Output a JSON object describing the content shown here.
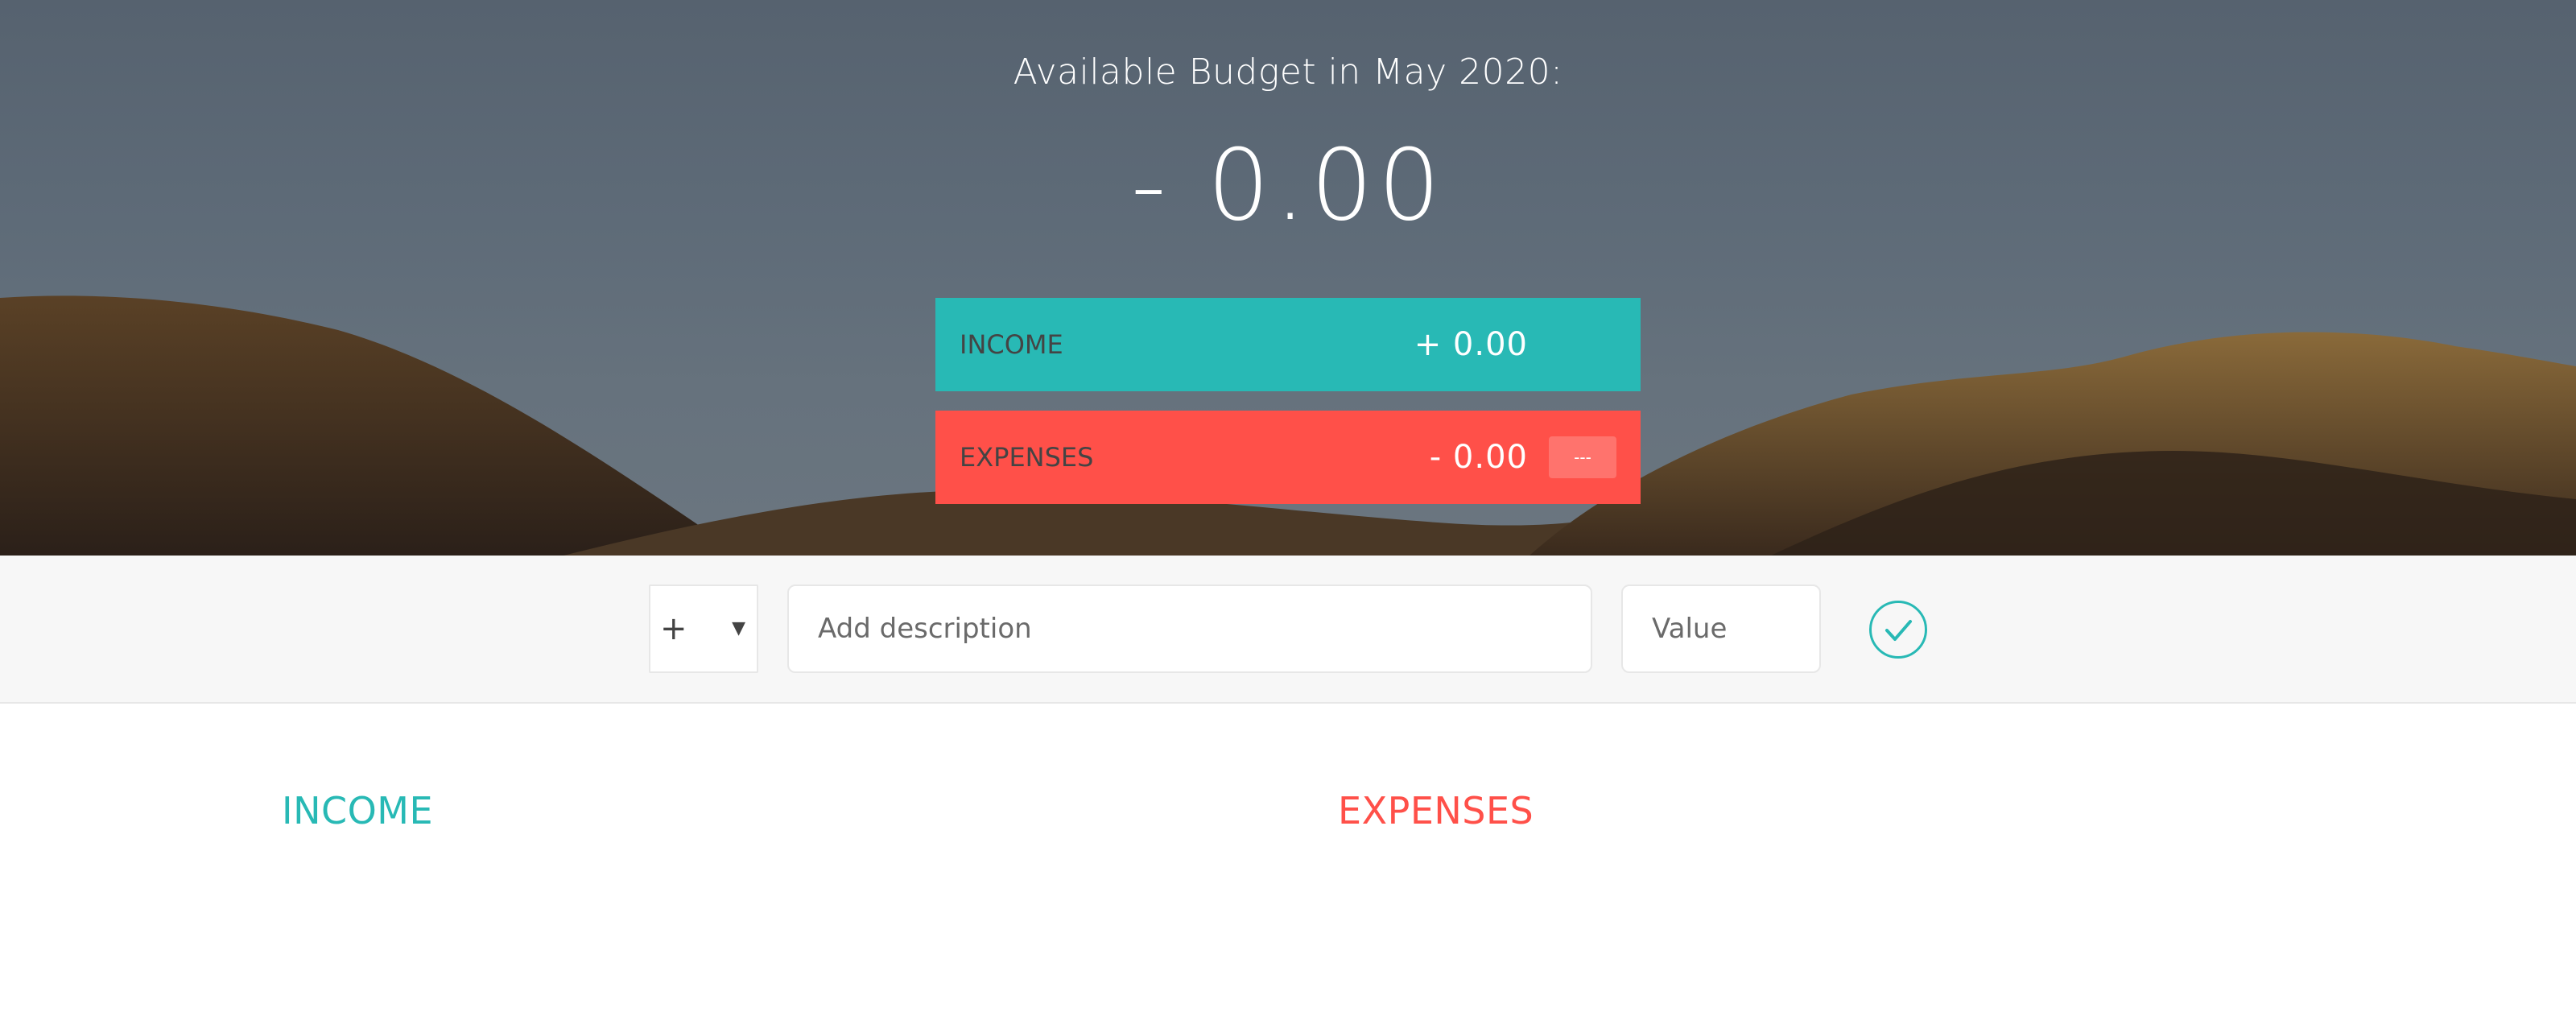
{
  "budget": {
    "title": "Available Budget in May 2020:",
    "value": "- 0.00",
    "income": {
      "label": "INCOME",
      "value": "+ 0.00"
    },
    "expenses": {
      "label": "EXPENSES",
      "value": "- 0.00",
      "percentage": "---"
    }
  },
  "add_form": {
    "type_selected": "+",
    "type_caret_icon": "caret-down-icon",
    "description_placeholder": "Add description",
    "value_placeholder": "Value",
    "submit_icon": "checkmark-circle-icon"
  },
  "lists": {
    "income_title": "INCOME",
    "expenses_title": "EXPENSES"
  },
  "colors": {
    "income": "#28b9b5",
    "expenses": "#ff5049",
    "form_bg": "#f7f7f7"
  }
}
